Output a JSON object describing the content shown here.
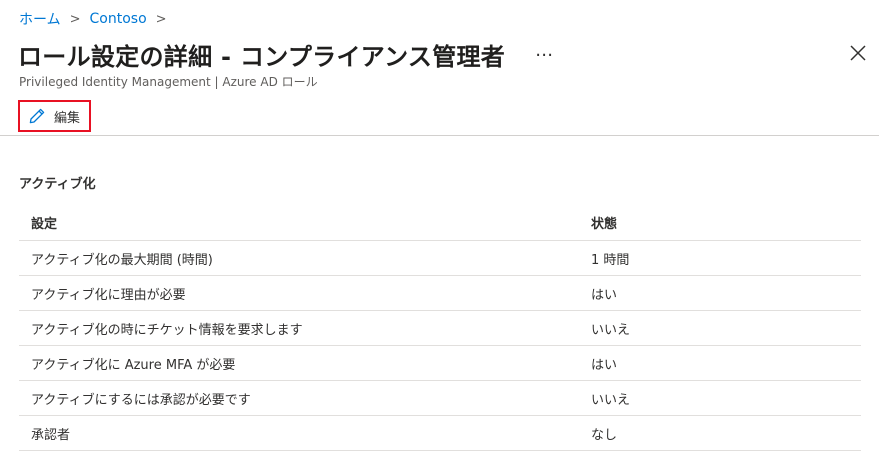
{
  "breadcrumb": {
    "home": "ホーム",
    "separator": ">",
    "org": "Contoso",
    "trailing_separator": ">"
  },
  "header": {
    "title": "ロール設定の詳細 - コンプライアンス管理者",
    "more": "…",
    "subtitle": "Privileged Identity Management | Azure AD ロール"
  },
  "toolbar": {
    "edit_label": "編集"
  },
  "section": {
    "title": "アクティブ化"
  },
  "table": {
    "columns": [
      "設定",
      "状態"
    ],
    "rows": [
      [
        "アクティブ化の最大期間 (時間)",
        "1 時間"
      ],
      [
        "アクティブ化に理由が必要",
        "はい"
      ],
      [
        "アクティブ化の時にチケット情報を要求します",
        "いいえ"
      ],
      [
        "アクティブ化に Azure MFA が必要",
        "はい"
      ],
      [
        "アクティブにするには承認が必要です",
        "いいえ"
      ],
      [
        "承認者",
        "なし"
      ]
    ]
  },
  "colors": {
    "link": "#0078d4",
    "highlight": "#e81123"
  },
  "icons": {
    "edit": "pencil-icon",
    "close": "close-icon",
    "more": "ellipsis-icon"
  }
}
